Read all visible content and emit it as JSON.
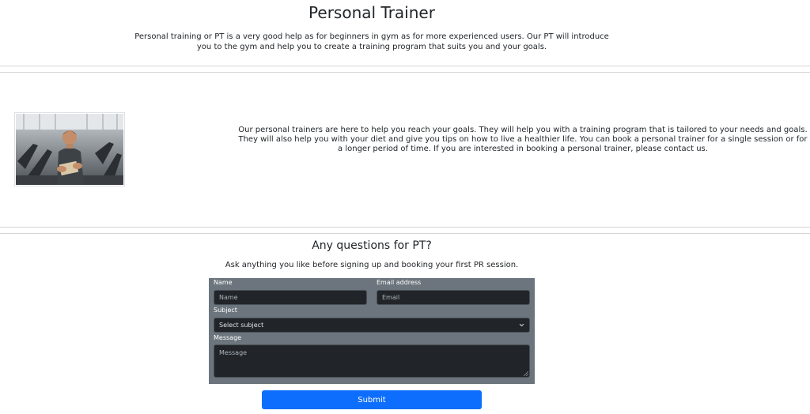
{
  "header": {
    "title": "Personal Trainer",
    "intro": "Personal training or PT is a very good help as for beginners in gym as for more experienced users. Our PT will introduce you to the gym and help you to create a training program that suits you and your goals."
  },
  "about": {
    "text": "Our personal trainers are here to help you reach your goals. They will help you with a training program that is tailored to your needs and goals. They will also help you with your diet and give you tips on how to live a healthier life. You can book a personal trainer for a single session or for a longer period of time. If you are interested in booking a personal trainer, please contact us."
  },
  "questions": {
    "title": "Any questions for PT?",
    "subtitle": "Ask anything you like before signing up and booking your first PR session."
  },
  "form": {
    "name_label": "Name",
    "name_placeholder": "Name",
    "email_label": "Email address",
    "email_placeholder": "Email",
    "subject_label": "Subject",
    "subject_value": "Select subject",
    "message_label": "Message",
    "message_placeholder": "Message",
    "submit_label": "Submit"
  },
  "colors": {
    "form_background": "#6c757d",
    "input_background": "#212529",
    "submit_button": "#0d6efd"
  },
  "icons": {
    "subject_dropdown": "chevron-down-icon",
    "image": "personal-trainer-photo"
  }
}
